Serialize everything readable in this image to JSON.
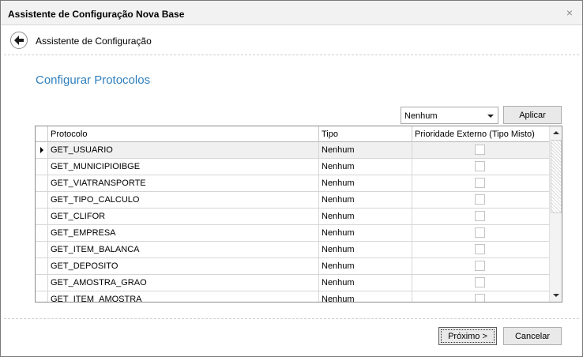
{
  "window": {
    "title": "Assistente de Configuração Nova Base",
    "close_glyph": "×"
  },
  "header": {
    "title": "Assistente de Configuração",
    "back_icon": "arrow-left-icon"
  },
  "section": {
    "title": "Configurar Protocolos"
  },
  "toolbar": {
    "select_value": "Nenhum",
    "apply_label": "Aplicar"
  },
  "grid": {
    "columns": [
      "Protocolo",
      "Tipo",
      "Prioridade Externo (Tipo Misto)"
    ],
    "rows": [
      {
        "protocolo": "GET_USUARIO",
        "tipo": "Nenhum",
        "prioridade": false,
        "selected": true
      },
      {
        "protocolo": "GET_MUNICIPIOIBGE",
        "tipo": "Nenhum",
        "prioridade": false
      },
      {
        "protocolo": "GET_VIATRANSPORTE",
        "tipo": "Nenhum",
        "prioridade": false
      },
      {
        "protocolo": "GET_TIPO_CALCULO",
        "tipo": "Nenhum",
        "prioridade": false
      },
      {
        "protocolo": "GET_CLIFOR",
        "tipo": "Nenhum",
        "prioridade": false
      },
      {
        "protocolo": "GET_EMPRESA",
        "tipo": "Nenhum",
        "prioridade": false
      },
      {
        "protocolo": "GET_ITEM_BALANCA",
        "tipo": "Nenhum",
        "prioridade": false
      },
      {
        "protocolo": "GET_DEPOSITO",
        "tipo": "Nenhum",
        "prioridade": false
      },
      {
        "protocolo": "GET_AMOSTRA_GRAO",
        "tipo": "Nenhum",
        "prioridade": false
      },
      {
        "protocolo": "GET_ITEM_AMOSTRA",
        "tipo": "Nenhum",
        "prioridade": false
      }
    ]
  },
  "footer": {
    "next_label": "Próximo >",
    "cancel_label": "Cancelar"
  },
  "colors": {
    "accent": "#2f7fbd",
    "border": "#8c8c8c",
    "button_bg": "#e9e9e9"
  }
}
